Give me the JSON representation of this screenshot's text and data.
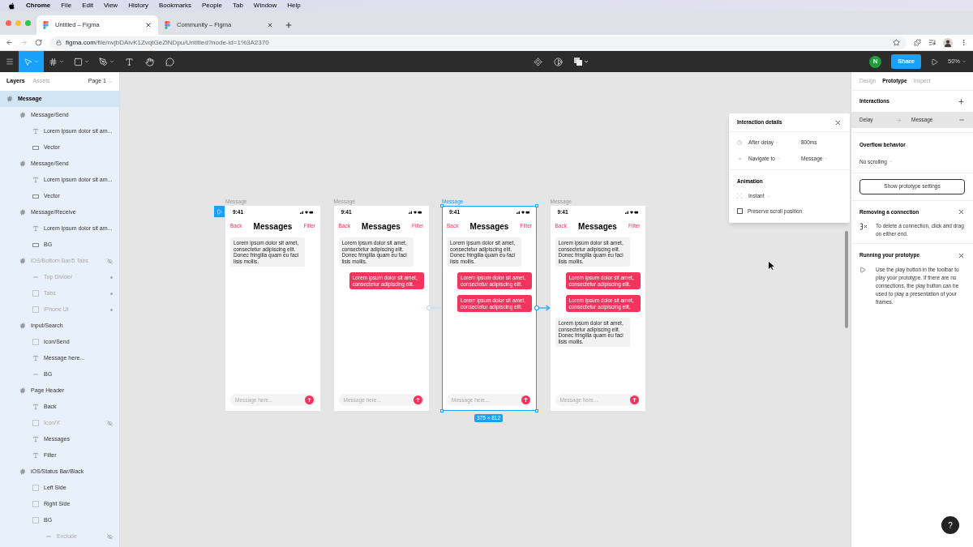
{
  "menu_bar": {
    "app": "Chrome",
    "items": [
      "File",
      "Edit",
      "View",
      "History",
      "Bookmarks",
      "People",
      "Tab",
      "Window",
      "Help"
    ]
  },
  "browser_tabs": [
    {
      "title": "Untitled – Figma",
      "selected": true
    },
    {
      "title": "Community – Figma",
      "selected": false
    }
  ],
  "address_bar": {
    "host": "figma.com",
    "path": "/file/nvjbDAivK1ZvqtGeZiNDpu/Untitled?node-id=1%3A2370"
  },
  "toolbar": {
    "tools": [
      {
        "kind": "move",
        "selected": true
      },
      {
        "kind": "frame",
        "selected": false
      },
      {
        "kind": "shape",
        "selected": false
      },
      {
        "kind": "pen",
        "selected": false
      },
      {
        "kind": "text",
        "selected": false
      },
      {
        "kind": "hand",
        "selected": false
      },
      {
        "kind": "comment",
        "selected": false
      }
    ],
    "avatar": "N",
    "share": "Share",
    "zoom": "50%"
  },
  "layers_panel": {
    "tabs": [
      {
        "label": "Layers",
        "selected": true
      },
      {
        "label": "Assets",
        "selected": false
      }
    ],
    "page": "Page 1",
    "items": [
      {
        "kind": "frame",
        "name": "Message",
        "selected": true,
        "hidden": false,
        "children": [
          {
            "kind": "frame",
            "name": "Message/Send",
            "selected": false,
            "hidden": false,
            "children": [
              {
                "kind": "text",
                "name": "Lorem ipsum dolor sit am...",
                "selected": false,
                "hidden": false
              },
              {
                "kind": "vector",
                "name": "Vector",
                "selected": false,
                "hidden": false
              }
            ]
          },
          {
            "kind": "frame",
            "name": "Message/Send",
            "selected": false,
            "hidden": false,
            "children": [
              {
                "kind": "text",
                "name": "Lorem ipsum dolor sit am...",
                "selected": false,
                "hidden": false
              },
              {
                "kind": "vector",
                "name": "Vector",
                "selected": false,
                "hidden": false
              }
            ]
          },
          {
            "kind": "frame",
            "name": "Message/Receive",
            "selected": false,
            "hidden": false,
            "children": [
              {
                "kind": "text",
                "name": "Lorem ipsum dolor sit am...",
                "selected": false,
                "hidden": false
              },
              {
                "kind": "vector",
                "name": "BG",
                "selected": false,
                "hidden": false
              }
            ]
          },
          {
            "kind": "frame",
            "name": "iOS/Bottom Bar/5 Tabs",
            "selected": false,
            "hidden": true,
            "children": [
              {
                "kind": "line",
                "name": "Top Divider",
                "selected": false,
                "hidden": false
              },
              {
                "kind": "group",
                "name": "Tabs",
                "selected": false,
                "hidden": false
              },
              {
                "kind": "group",
                "name": "iPhone UI",
                "selected": false,
                "hidden": false
              }
            ]
          },
          {
            "kind": "frame",
            "name": "Input/Search",
            "selected": false,
            "hidden": false,
            "children": [
              {
                "kind": "group",
                "name": "Icon/Send",
                "selected": false,
                "hidden": false
              },
              {
                "kind": "text",
                "name": "Message here...",
                "selected": false,
                "hidden": false
              },
              {
                "kind": "line",
                "name": "BG",
                "selected": false,
                "hidden": false
              }
            ]
          },
          {
            "kind": "frame",
            "name": "Page Header",
            "selected": false,
            "hidden": false,
            "children": [
              {
                "kind": "text",
                "name": "Back",
                "selected": false,
                "hidden": false
              },
              {
                "kind": "group",
                "name": "Icon/X",
                "selected": false,
                "hidden": true
              },
              {
                "kind": "text",
                "name": "Messages",
                "selected": false,
                "hidden": false
              },
              {
                "kind": "text",
                "name": "Filter",
                "selected": false,
                "hidden": false
              }
            ]
          },
          {
            "kind": "frame",
            "name": "iOS/Status Bar/Black",
            "selected": false,
            "hidden": false,
            "children": [
              {
                "kind": "group",
                "name": "Left Side",
                "selected": false,
                "hidden": false
              },
              {
                "kind": "group",
                "name": "Right Side",
                "selected": false,
                "hidden": false
              },
              {
                "kind": "group",
                "name": "BG",
                "selected": false,
                "hidden": false,
                "children": [
                  {
                    "kind": "line",
                    "name": "Exclude",
                    "selected": false,
                    "hidden": true
                  }
                ]
              }
            ]
          }
        ]
      }
    ]
  },
  "canvas": {
    "frames": [
      {
        "label": "Message",
        "selected": false,
        "starting_point": true,
        "time": "9:41",
        "back": "Back",
        "title": "Messages",
        "filter": "Filter",
        "input_placeholder": "Message here...",
        "messages": [
          {
            "kind": "receive",
            "text": "Lorem ipsum dolor sit amet, consectetur adipiscing elit. Donec fringilla quam eu faci lisis mollis."
          }
        ]
      },
      {
        "label": "Message",
        "selected": false,
        "starting_point": false,
        "time": "9:41",
        "back": "Back",
        "title": "Messages",
        "filter": "Filter",
        "input_placeholder": "Message here...",
        "messages": [
          {
            "kind": "receive",
            "text": "Lorem ipsum dolor sit amet, consectetur adipiscing elit. Donec fringilla quam eu faci lisis mollis."
          },
          {
            "kind": "send",
            "text": "Lorem ipsum dolor sit amet, consectetur adipiscing elit."
          }
        ]
      },
      {
        "label": "Message",
        "selected": true,
        "starting_point": false,
        "size": "375 × 812",
        "time": "9:41",
        "back": "Back",
        "title": "Messages",
        "filter": "Filter",
        "input_placeholder": "Message here...",
        "messages": [
          {
            "kind": "receive",
            "text": "Lorem ipsum dolor sit amet, consectetur adipiscing elit. Donec fringilla quam eu faci lisis mollis."
          },
          {
            "kind": "send",
            "text": "Lorem ipsum dolor sit amet, consectetur adipiscing elit."
          },
          {
            "kind": "send",
            "text": "Lorem ipsum dolor sit amet, consectetur adipiscing elit."
          }
        ]
      },
      {
        "label": "Message",
        "selected": false,
        "starting_point": false,
        "time": "9:41",
        "back": "Back",
        "title": "Messages",
        "filter": "Filter",
        "input_placeholder": "Message here...",
        "messages": [
          {
            "kind": "receive",
            "text": "Lorem ipsum dolor sit amet, consectetur adipiscing elit. Donec fringilla quam eu faci lisis mollis."
          },
          {
            "kind": "send",
            "text": "Lorem ipsum dolor sit amet, consectetur adipiscing elit."
          },
          {
            "kind": "send",
            "text": "Lorem ipsum dolor sit amet, consectetur adipiscing elit."
          },
          {
            "kind": "receive",
            "text": "Lorem ipsum dolor sit amet, consectetur adipiscing elit. Donec fringilla quam eu faci lisis mollis."
          }
        ]
      }
    ],
    "connections": [
      {
        "selected": false
      },
      {
        "selected": true
      }
    ],
    "interaction_details": {
      "title": "Interaction details",
      "trigger": "After delay",
      "delay": "800ms",
      "action": "Navigate to",
      "destination": "Message",
      "animation_heading": "Animation",
      "animation": "Instant",
      "preserve_scroll": {
        "label": "Preserve scroll position",
        "checked": false
      }
    }
  },
  "right_panel": {
    "tabs": [
      {
        "label": "Design",
        "selected": false
      },
      {
        "label": "Prototype",
        "selected": true
      },
      {
        "label": "Inspect",
        "selected": false
      }
    ],
    "interactions_heading": "Interactions",
    "interactions": [
      {
        "trigger": "Delay",
        "destination": "Message",
        "selected": true
      }
    ],
    "overflow_heading": "Overflow behavior",
    "overflow": "No scrolling",
    "settings_button": "Show prototype settings",
    "tips": [
      {
        "kind": "connection",
        "title": "Removing a connection",
        "text": "To delete a connection, click and drag on either end."
      },
      {
        "kind": "play",
        "title": "Running your prototype",
        "text": "Use the play button in the toolbar to play your prototype. If there are no connections, the play button can be used to play a presentation of your frames."
      }
    ]
  },
  "help": "?"
}
